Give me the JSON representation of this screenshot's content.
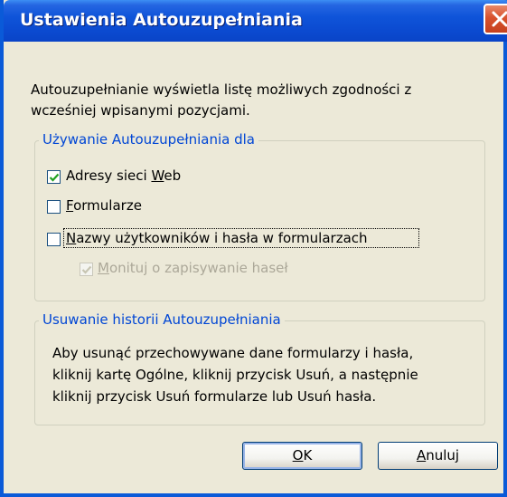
{
  "window": {
    "title": "Ustawienia Autouzupełniania"
  },
  "description": {
    "line1": "Autouzupełnianie wyświetla listę możliwych zgodności z",
    "line2": "wcześniej wpisanymi pozycjami."
  },
  "use_group": {
    "legend": "Używanie Autouzupełniania dla",
    "web_addresses": {
      "label_pre": "Adresy sieci ",
      "label_key": "W",
      "label_post": "eb",
      "checked": true
    },
    "forms": {
      "label_key": "F",
      "label_post": "ormularze",
      "checked": false
    },
    "usernames": {
      "label_key": "N",
      "label_post": "azwy użytkowników i hasła w formularzach",
      "checked": false
    },
    "prompt_save": {
      "label_key": "M",
      "label_post": "onituj o zapisywanie haseł",
      "checked": true,
      "disabled": true
    }
  },
  "clear_group": {
    "legend": "Usuwanie historii Autouzupełniania",
    "line1": "Aby usunąć przechowywane dane formularzy i hasła,",
    "line2": "kliknij kartę Ogólne, kliknij przycisk Usuń, a następnie",
    "line3": "kliknij przycisk Usuń formularze lub Usuń hasła."
  },
  "buttons": {
    "ok_key": "O",
    "ok_post": "K",
    "cancel_key": "A",
    "cancel_post": "nuluj"
  },
  "colors": {
    "titlebar": "#0a4ad0",
    "legend": "#0046d5",
    "checkmark": "#21a121",
    "close": "#d8522d"
  }
}
